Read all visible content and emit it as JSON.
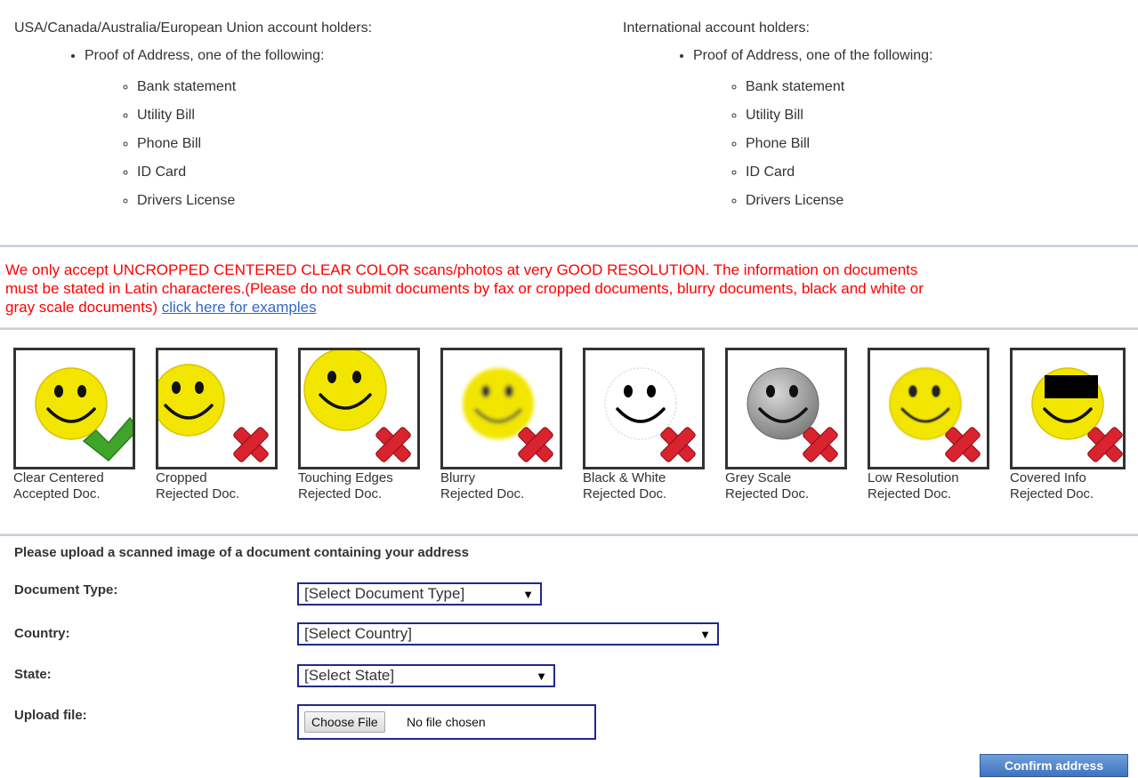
{
  "requirements": {
    "left": {
      "heading": "USA/Canada/Australia/European Union account holders:",
      "item": "Proof of Address, one of the following:",
      "docs": [
        "Bank statement",
        "Utility Bill",
        "Phone Bill",
        "ID Card",
        "Drivers License"
      ]
    },
    "right": {
      "heading": "International account holders:",
      "item": "Proof of Address, one of the following:",
      "docs": [
        "Bank statement",
        "Utility Bill",
        "Phone Bill",
        "ID Card",
        "Drivers License"
      ]
    }
  },
  "warning": {
    "line1": "We only accept UNCROPPED CENTERED CLEAR COLOR scans/photos at very GOOD RESOLUTION. The information on documents",
    "line2": "must be stated in Latin characteres.(Please do not submit documents by fax or cropped documents, blurry documents, black and white or",
    "line3": "gray scale documents)",
    "link": "click here for examples"
  },
  "examples": [
    {
      "line1": "Clear Centered",
      "line2": "Accepted Doc.",
      "status": "accepted",
      "icon": "check-icon"
    },
    {
      "line1": "Cropped",
      "line2": "Rejected Doc.",
      "status": "rejected",
      "icon": "x-icon"
    },
    {
      "line1": "Touching Edges",
      "line2": "Rejected Doc.",
      "status": "rejected",
      "icon": "x-icon"
    },
    {
      "line1": "Blurry",
      "line2": "Rejected Doc.",
      "status": "rejected",
      "icon": "x-icon"
    },
    {
      "line1": "Black & White",
      "line2": "Rejected Doc.",
      "status": "rejected",
      "icon": "x-icon"
    },
    {
      "line1": "Grey Scale",
      "line2": "Rejected Doc.",
      "status": "rejected",
      "icon": "x-icon"
    },
    {
      "line1": "Low Resolution",
      "line2": "Rejected Doc.",
      "status": "rejected",
      "icon": "x-icon"
    },
    {
      "line1": "Covered Info",
      "line2": "Rejected Doc.",
      "status": "rejected",
      "icon": "x-icon"
    }
  ],
  "form": {
    "title": "Please upload a scanned image of a document containing your address",
    "document_type": {
      "label": "Document Type:",
      "value": "[Select Document Type]"
    },
    "country": {
      "label": "Country:",
      "value": "[Select Country]"
    },
    "state": {
      "label": "State:",
      "value": "[Select State]"
    },
    "upload": {
      "label": "Upload file:",
      "button": "Choose File",
      "status": "No file chosen"
    },
    "confirm_label": "Confirm address"
  },
  "colors": {
    "warning_text": "#ff0000",
    "link": "#3366cc",
    "select_border": "#1f2a8a",
    "confirm_button": "#4a7fc8",
    "smiley_yellow": "#f2e600",
    "accept_green": "#3fa52a",
    "reject_red": "#d9232e"
  }
}
